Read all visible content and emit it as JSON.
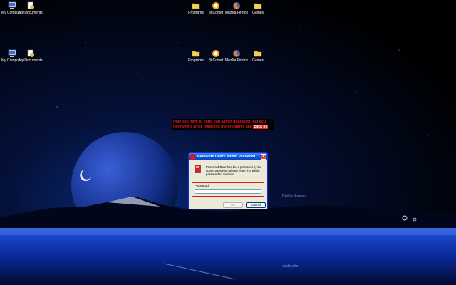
{
  "desktop": {
    "icons": [
      {
        "label": "My Computer",
        "icon": "computer-icon"
      },
      {
        "label": "My Documents",
        "icon": "documents-icon"
      },
      {
        "label": "Programs",
        "icon": "folder-icon"
      },
      {
        "label": "BitComet",
        "icon": "bitcomet-icon"
      },
      {
        "label": "Mozilla Firefox",
        "icon": "firefox-icon"
      },
      {
        "label": "Games",
        "icon": "folder-icon"
      },
      {
        "label": "My Computer",
        "icon": "computer-icon"
      },
      {
        "label": "My Documents",
        "icon": "documents-icon"
      },
      {
        "label": "Programs",
        "icon": "folder-icon"
      },
      {
        "label": "BitComet",
        "icon": "bitcomet-icon"
      },
      {
        "label": "Mozilla Firefox",
        "icon": "firefox-icon"
      },
      {
        "label": "Games",
        "icon": "folder-icon"
      }
    ],
    "wallpaper_caption": "Nightly Journey",
    "wallpaper_signature": "vladstudio"
  },
  "note": {
    "text": "Now you have to enter you admin password that you have wrote while installing the programs and",
    "highlight": "click ok"
  },
  "dialog": {
    "title": "Password Door / Admin Password",
    "message": "Password Door has been protected by the admin password, please enter the admin password to continue.",
    "password_label": "Password:",
    "password_value": "",
    "ok_label": "OK",
    "cancel_label": "Cancel",
    "close_label": "×"
  },
  "colors": {
    "title_bar": "#0a4fd6",
    "highlight_red": "#d62020"
  }
}
